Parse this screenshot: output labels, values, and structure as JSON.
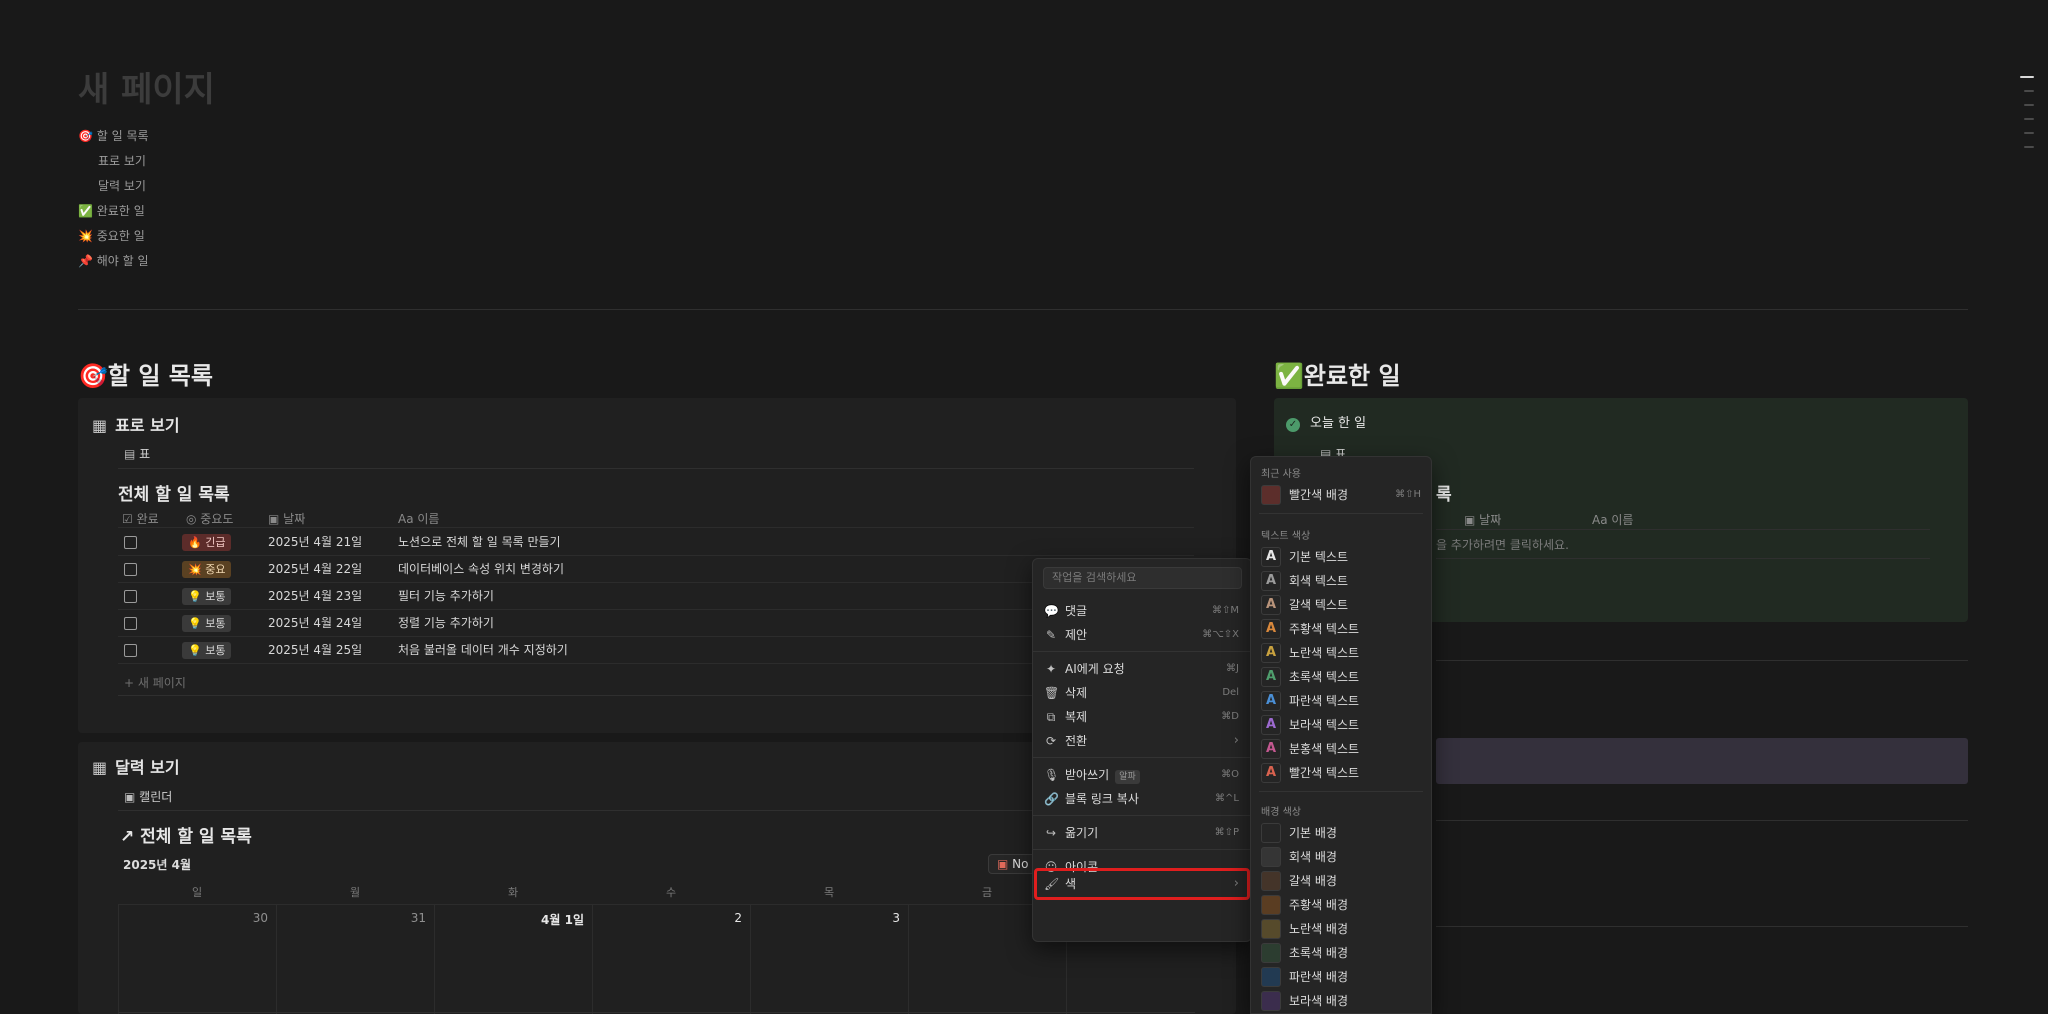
{
  "page": {
    "title": "새 페이지",
    "toc": [
      {
        "label": "🎯 할 일 목록"
      },
      {
        "label": "표로 보기"
      },
      {
        "label": "달력 보기"
      },
      {
        "label": "✅ 완료한 일"
      },
      {
        "label": "💥 중요한 일"
      },
      {
        "label": "📌 해야 할 일"
      }
    ]
  },
  "todo_section": {
    "heading": "🎯할 일 목록",
    "table_view": {
      "title": "표로 보기",
      "tab": "표",
      "db_title": "전체 할 일 목록",
      "columns": [
        "완료",
        "중요도",
        "날짜",
        "이름"
      ],
      "rows": [
        {
          "priority": "🔥 긴급",
          "priority_type": "urgent",
          "date": "2025년 4월 21일",
          "name": "노션으로 전체 할 일 목록 만들기"
        },
        {
          "priority": "💥 중요",
          "priority_type": "important",
          "date": "2025년 4월 22일",
          "name": "데이터베이스 속성 위치 변경하기"
        },
        {
          "priority": "💡 보통",
          "priority_type": "normal",
          "date": "2025년 4월 23일",
          "name": "필터 기능 추가하기"
        },
        {
          "priority": "💡 보통",
          "priority_type": "normal",
          "date": "2025년 4월 24일",
          "name": "정렬 기능 추가하기"
        },
        {
          "priority": "💡 보통",
          "priority_type": "normal",
          "date": "2025년 4월 25일",
          "name": "처음 불러올 데이터 개수 지정하기"
        }
      ],
      "new_page": "새 페이지"
    },
    "calendar_view": {
      "title": "달력 보기",
      "tab": "캘린더",
      "db_title": "↗ 전체 할 일 목록",
      "month": "2025년 4월",
      "button_partial": "No",
      "weekdays": [
        "일",
        "월",
        "화",
        "수",
        "목",
        "금"
      ],
      "days": [
        "30",
        "31",
        "4월 1일",
        "2",
        "3"
      ]
    }
  },
  "done_section": {
    "heading": "✅완료한 일",
    "card_title": "오늘 한 일",
    "tab": "표",
    "db_title_partial": "록",
    "columns": [
      "날짜",
      "이름"
    ],
    "empty_hint": "을 추가하려면 클릭하세요."
  },
  "context_menu": {
    "search_placeholder": "작업을 검색하세요",
    "items": [
      {
        "icon": "comment-icon",
        "glyph": "💬",
        "label": "댓글",
        "shortcut": "⌘⇧M"
      },
      {
        "icon": "suggest-icon",
        "glyph": "✎",
        "label": "제안",
        "shortcut": "⌘⌥⇧X"
      },
      {
        "icon": "ai-icon",
        "glyph": "✦",
        "label": "AI에게 요청",
        "shortcut": "⌘J"
      },
      {
        "icon": "trash-icon",
        "glyph": "🗑",
        "label": "삭제",
        "shortcut": "Del"
      },
      {
        "icon": "duplicate-icon",
        "glyph": "⧉",
        "label": "복제",
        "shortcut": "⌘D"
      },
      {
        "icon": "convert-icon",
        "glyph": "⟳",
        "label": "전환",
        "shortcut": "›"
      },
      {
        "icon": "mic-icon",
        "glyph": "🎙",
        "label": "받아쓰기",
        "badge": "알파",
        "shortcut": "⌘O"
      },
      {
        "icon": "link-icon",
        "glyph": "🔗",
        "label": "블록 링크 복사",
        "shortcut": "⌘^L"
      },
      {
        "icon": "move-icon",
        "glyph": "↪",
        "label": "옮기기",
        "shortcut": "⌘⇧P"
      },
      {
        "icon": "emoji-icon",
        "glyph": "☺",
        "label": "아이콘",
        "shortcut": ""
      },
      {
        "icon": "paint-icon",
        "glyph": "🖌",
        "label": "색",
        "shortcut": "›"
      }
    ]
  },
  "color_menu": {
    "recent_head": "최근 사용",
    "recent": [
      {
        "label": "빨간색 배경",
        "shortcut": "⌘⇧H",
        "color": "#5c2e2b"
      }
    ],
    "text_head": "텍스트 색상",
    "text_colors": [
      {
        "label": "기본 텍스트",
        "color": "#e6e6e6"
      },
      {
        "label": "회색 텍스트",
        "color": "#9b9b9b"
      },
      {
        "label": "갈색 텍스트",
        "color": "#b8937a"
      },
      {
        "label": "주황색 텍스트",
        "color": "#d9883c"
      },
      {
        "label": "노란색 텍스트",
        "color": "#c9a23f"
      },
      {
        "label": "초록색 텍스트",
        "color": "#4f9e6d"
      },
      {
        "label": "파란색 텍스트",
        "color": "#4a8fd6"
      },
      {
        "label": "보라색 텍스트",
        "color": "#9d6ad0"
      },
      {
        "label": "분홍색 텍스트",
        "color": "#c45891"
      },
      {
        "label": "빨간색 텍스트",
        "color": "#d9624f"
      }
    ],
    "bg_head": "배경 색상",
    "bg_colors": [
      {
        "label": "기본 배경",
        "color": "#262626"
      },
      {
        "label": "회색 배경",
        "color": "#353535"
      },
      {
        "label": "갈색 배경",
        "color": "#443429"
      },
      {
        "label": "주황색 배경",
        "color": "#5a3d22"
      },
      {
        "label": "노란색 배경",
        "color": "#564a2b"
      },
      {
        "label": "초록색 배경",
        "color": "#2c3d30"
      },
      {
        "label": "파란색 배경",
        "color": "#223a52"
      },
      {
        "label": "보라색 배경",
        "color": "#3b2d4d"
      }
    ]
  }
}
